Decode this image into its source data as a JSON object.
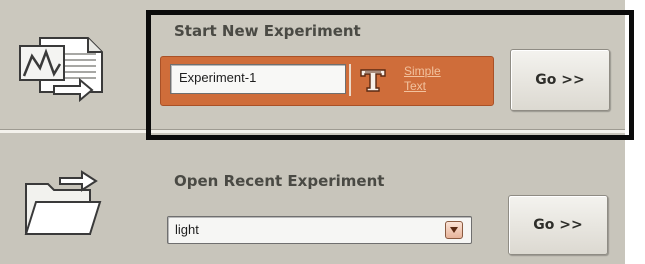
{
  "start_new": {
    "heading": "Start New Experiment",
    "icon": "chart-export-icon",
    "name_input_value": "Experiment-1",
    "text_icon": "text-format-icon",
    "simple_text_line1": "Simple",
    "simple_text_line2": "Text",
    "go_label": "Go >>"
  },
  "open_recent": {
    "heading": "Open Recent Experiment",
    "icon": "folder-open-icon",
    "selected_value": "light",
    "dropdown_icon": "chevron-down-icon",
    "go_label": "Go >>"
  },
  "colors": {
    "panel": "#cbc8be",
    "accent_orange": "#cf6d3a",
    "highlight_border": "#0b0b0b"
  }
}
